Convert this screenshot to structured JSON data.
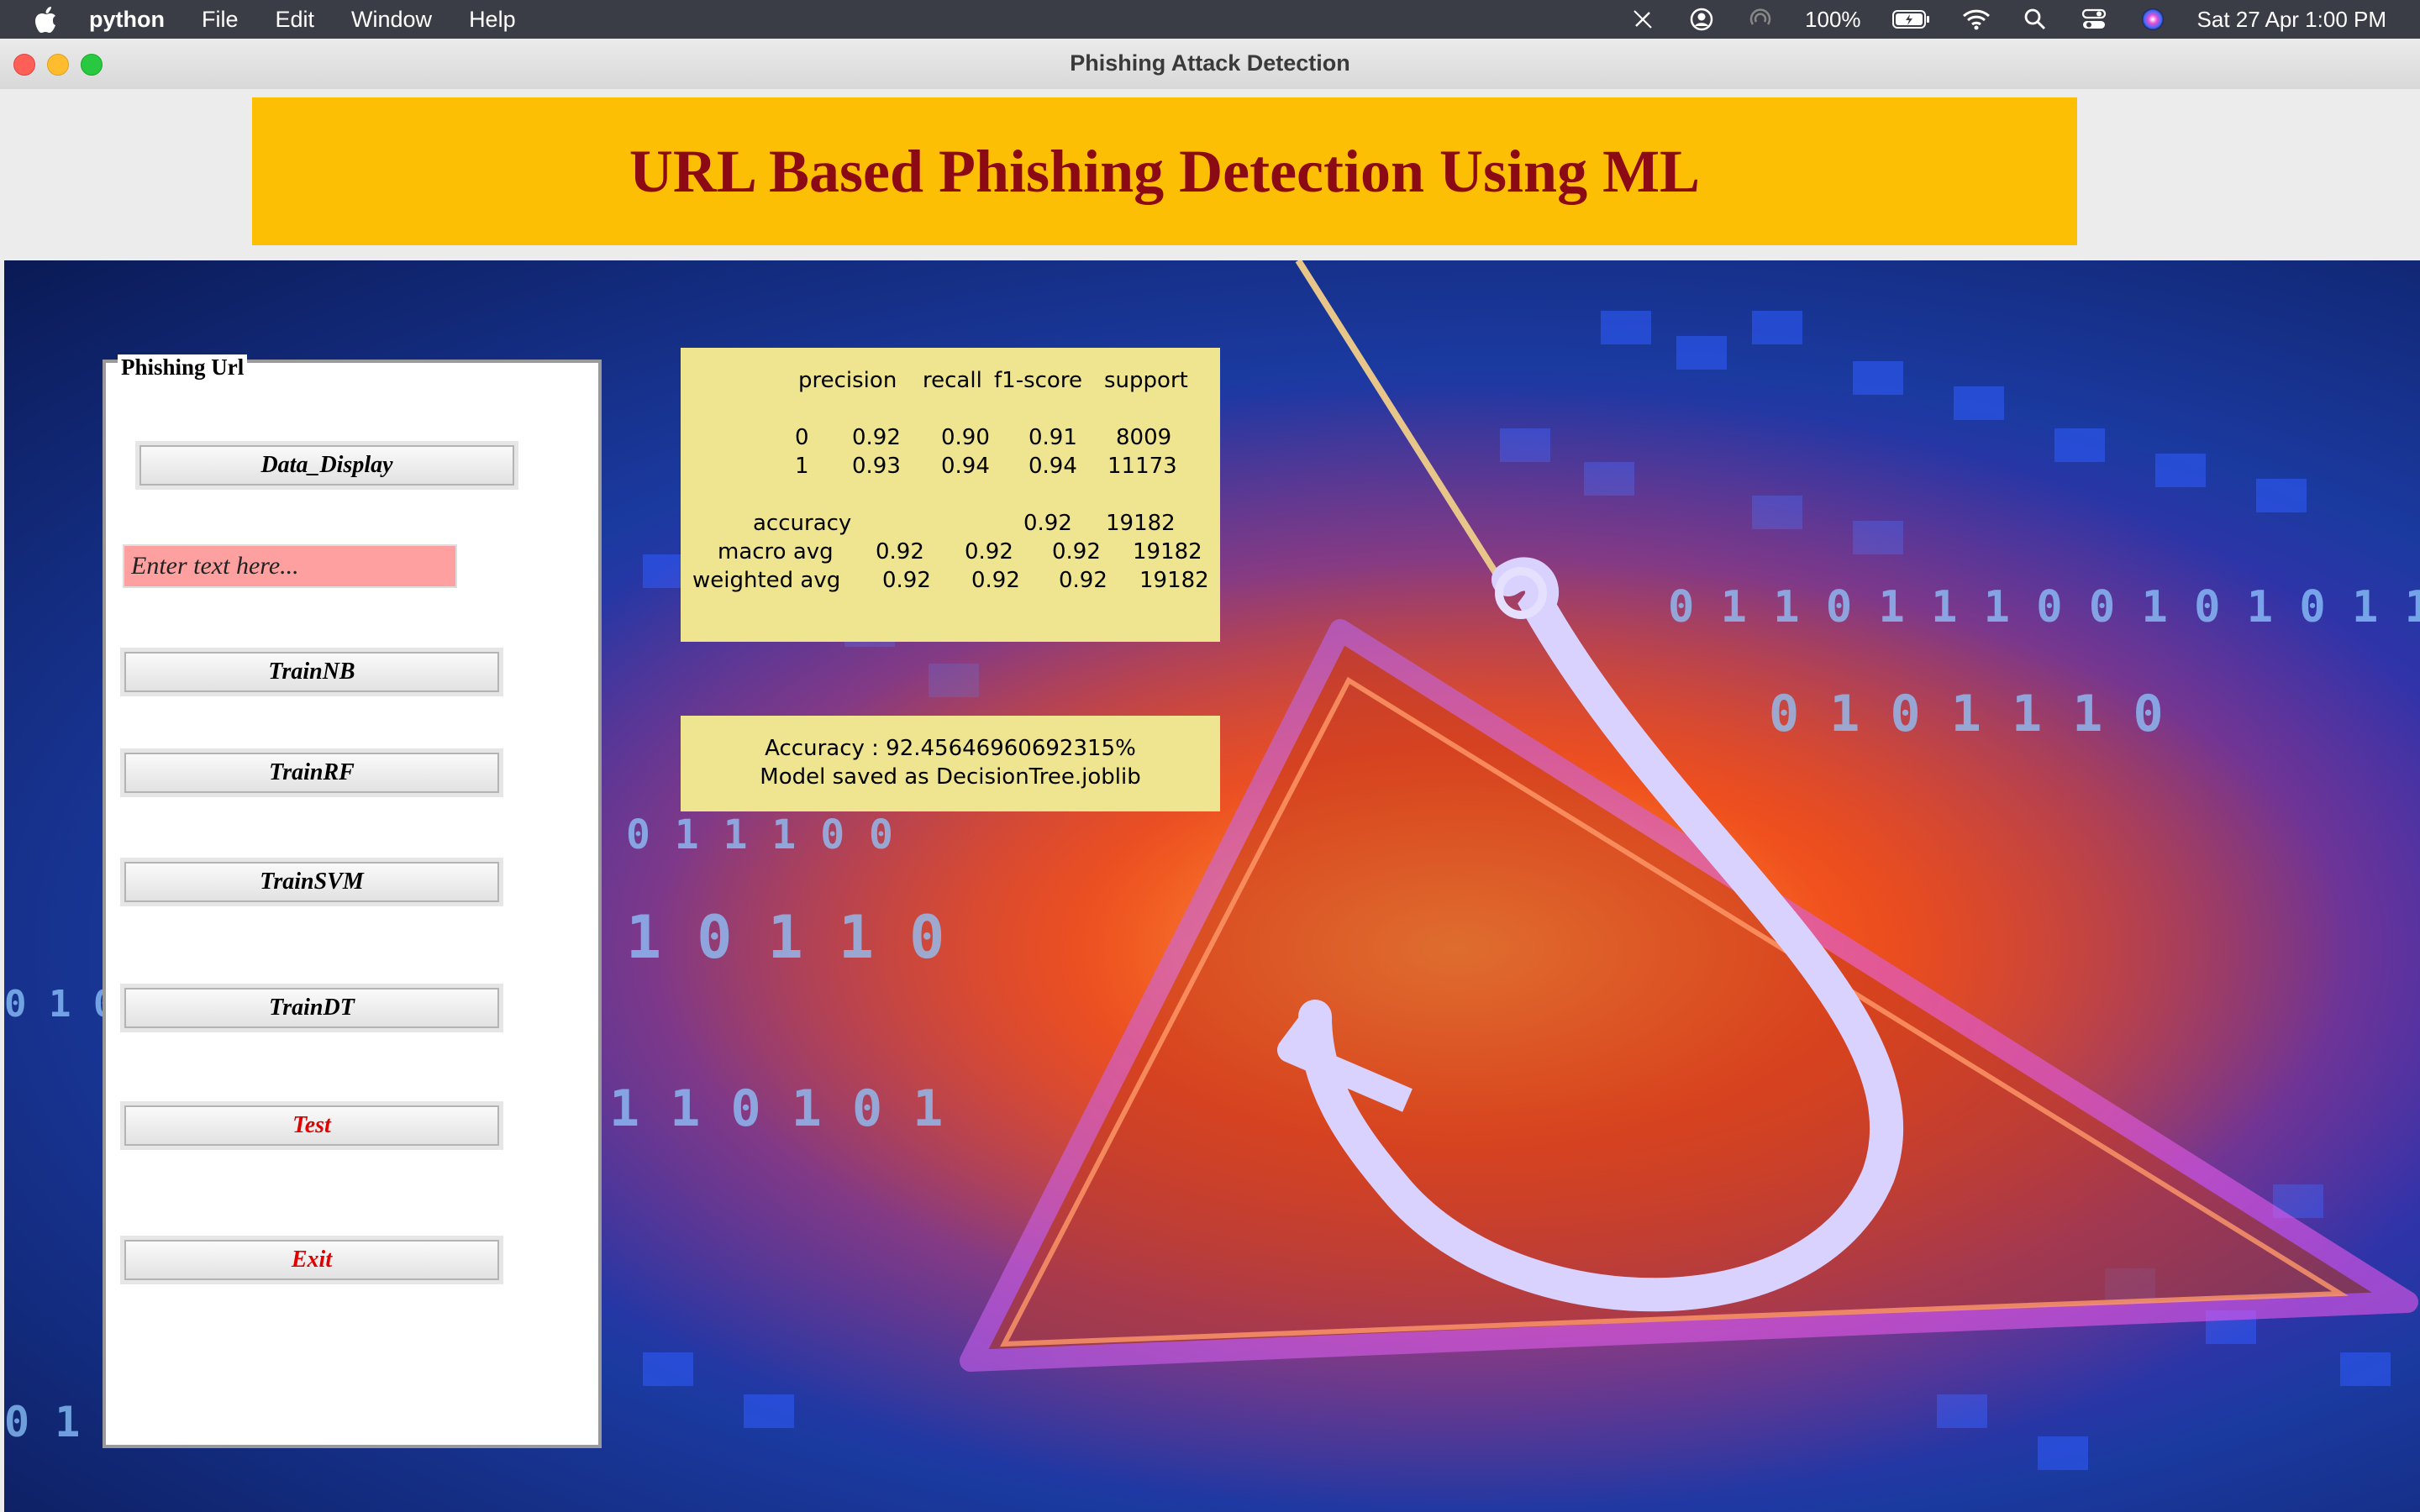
{
  "menubar": {
    "app_name": "python",
    "items": [
      "File",
      "Edit",
      "Window",
      "Help"
    ],
    "battery": "100%",
    "datetime": "Sat 27 Apr  1:00 PM"
  },
  "window": {
    "title": "Phishing Attack Detection"
  },
  "banner": {
    "title": "URL Based Phishing Detection Using ML",
    "bg_color": "#fdbf04",
    "text_color": "#8b0a14"
  },
  "panel": {
    "legend": "Phishing Url",
    "buttons": {
      "data_display": "Data_Display",
      "train_nb": "TrainNB",
      "train_rf": "TrainRF",
      "train_svm": "TrainSVM",
      "train_dt": "TrainDT",
      "test": "Test",
      "exit": "Exit"
    },
    "input": {
      "placeholder": "Enter text here...",
      "value": ""
    }
  },
  "report": {
    "headers": [
      "precision",
      "recall",
      "f1-score",
      "support"
    ],
    "rows": [
      {
        "label": "0",
        "precision": "0.92",
        "recall": "0.90",
        "f1": "0.91",
        "support": "8009"
      },
      {
        "label": "1",
        "precision": "0.93",
        "recall": "0.94",
        "f1": "0.94",
        "support": "11173"
      }
    ],
    "accuracy": {
      "label": "accuracy",
      "f1": "0.92",
      "support": "19182"
    },
    "macro": {
      "label": "macro avg",
      "precision": "0.92",
      "recall": "0.92",
      "f1": "0.92",
      "support": "19182"
    },
    "weighted": {
      "label": "weighted avg",
      "precision": "0.92",
      "recall": "0.92",
      "f1": "0.92",
      "support": "19182"
    }
  },
  "result": {
    "accuracy_text": "Accuracy : 92.45646960692315%",
    "model_text": "Model saved as DecisionTree.joblib"
  }
}
